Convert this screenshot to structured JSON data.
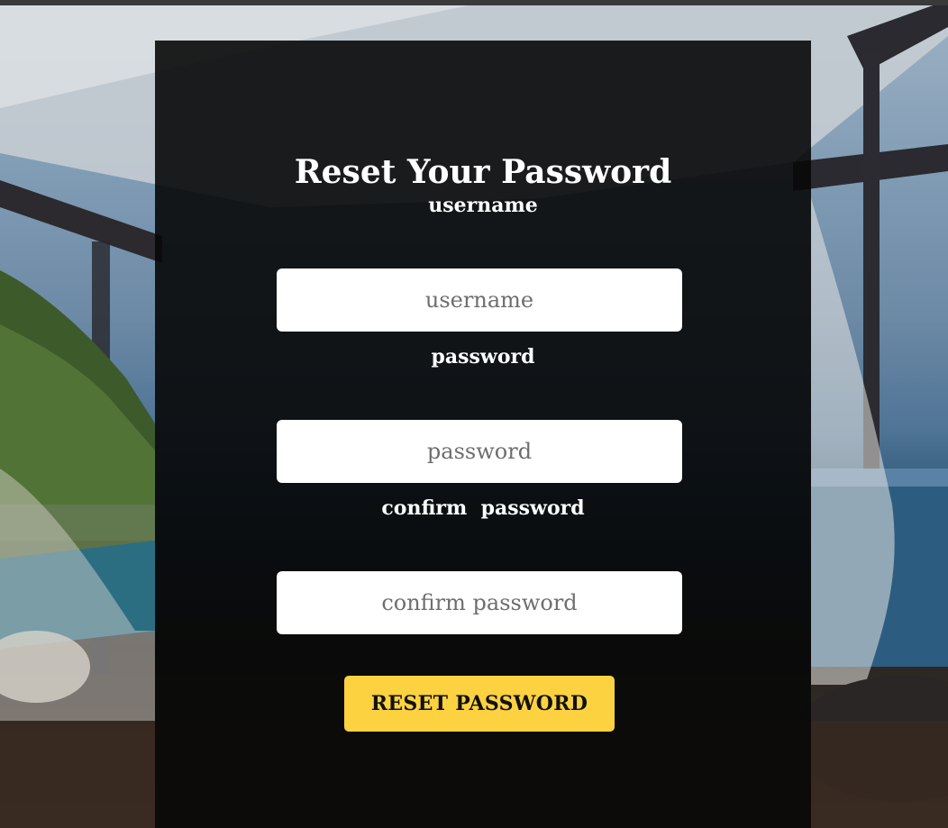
{
  "form": {
    "title": "Reset Your Password",
    "fields": [
      {
        "label": "username",
        "placeholder": "username",
        "value": ""
      },
      {
        "label": "password",
        "placeholder": "password",
        "value": ""
      },
      {
        "label": "confirm  password",
        "placeholder": "confirm password",
        "value": ""
      }
    ],
    "submit_label": "RESET PASSWORD"
  },
  "colors": {
    "panel": "#080808",
    "button": "#fcd240",
    "input_bg": "#ffffff",
    "text": "#ffffff"
  }
}
